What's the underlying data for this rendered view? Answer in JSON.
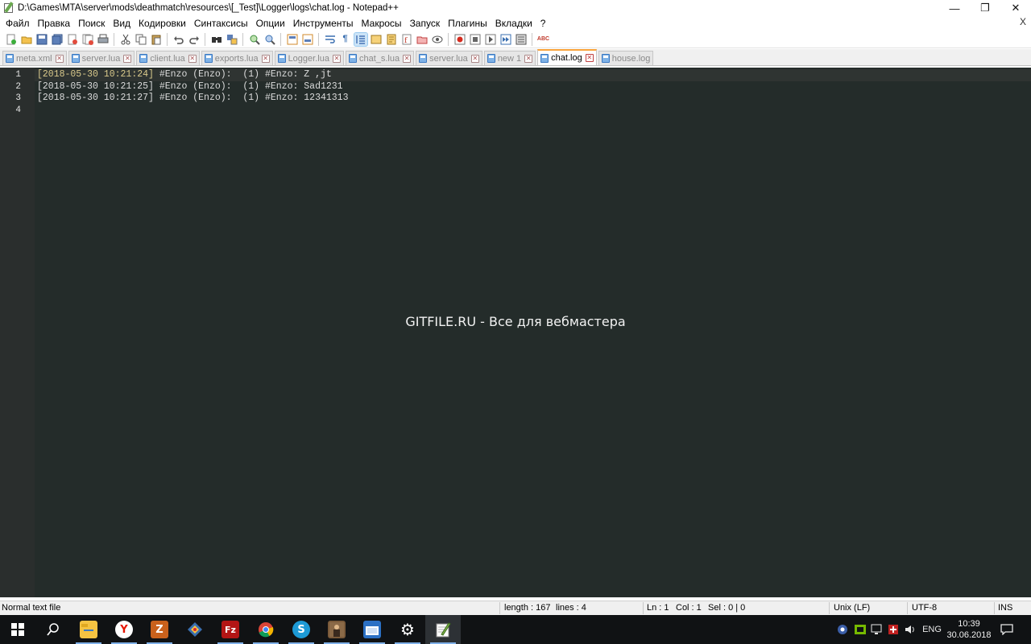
{
  "window": {
    "title": "D:\\Games\\MTA\\server\\mods\\deathmatch\\resources\\[_Test]\\Logger\\logs\\chat.log - Notepad++",
    "controls": {
      "minimize": "—",
      "restore": "❐",
      "close": "✕"
    }
  },
  "menu": {
    "items": [
      "Файл",
      "Правка",
      "Поиск",
      "Вид",
      "Кодировки",
      "Синтаксисы",
      "Опции",
      "Инструменты",
      "Макросы",
      "Запуск",
      "Плагины",
      "Вкладки",
      "?"
    ],
    "close_label": "X"
  },
  "toolbar": {
    "icons": [
      "new-icon",
      "open-icon",
      "save-icon",
      "save-all-icon",
      "close-icon",
      "close-all-icon",
      "print-icon",
      "cut-icon",
      "copy-icon",
      "paste-icon",
      "undo-icon",
      "redo-icon",
      "find-icon",
      "replace-icon",
      "zoom-in-icon",
      "zoom-out-icon",
      "sync-vertical-icon",
      "sync-horizontal-icon",
      "word-wrap-icon",
      "show-all-chars-icon",
      "indent-guide-icon",
      "user-language-icon",
      "document-map-icon",
      "function-list-icon",
      "folder-as-workspace-icon",
      "monitoring-icon",
      "record-macro-icon",
      "stop-record-icon",
      "play-macro-icon",
      "run-macro-multiple-icon",
      "save-macro-icon",
      "spell-check-icon"
    ],
    "active_icon": "indent-guide-icon"
  },
  "tabs": [
    {
      "label": "meta.xml",
      "active": false
    },
    {
      "label": "server.lua",
      "active": false
    },
    {
      "label": "client.lua",
      "active": false
    },
    {
      "label": "exports.lua",
      "active": false
    },
    {
      "label": "Logger.lua",
      "active": false
    },
    {
      "label": "chat_s.lua",
      "active": false
    },
    {
      "label": "server.lua",
      "active": false
    },
    {
      "label": "new 1",
      "active": false
    },
    {
      "label": "chat.log",
      "active": true
    },
    {
      "label": "house.log",
      "active": false
    }
  ],
  "editor": {
    "line_numbers": [
      "1",
      "2",
      "3",
      "4"
    ],
    "lines": [
      {
        "timestamp": "[2018-05-30 10:21:24]",
        "text": " #Enzo (Enzo):  (1) #Enzo: Z ,jt"
      },
      {
        "timestamp": "[2018-05-30 10:21:25]",
        "text": " #Enzo (Enzo):  (1) #Enzo: Sad1231"
      },
      {
        "timestamp": "[2018-05-30 10:21:27]",
        "text": " #Enzo (Enzo):  (1) #Enzo: 12341313"
      },
      {
        "timestamp": "",
        "text": ""
      }
    ],
    "watermark": "GITFILE.RU - Все для вебмастера",
    "colors": {
      "background": "#242c2a",
      "gutter": "#2a2e2d",
      "text": "#dcdcdc",
      "timestamp": "#d9c98b"
    }
  },
  "statusbar": {
    "file_type": "Normal text file",
    "length": "length : 167",
    "lines": "lines : 4",
    "ln": "Ln : 1",
    "col": "Col : 1",
    "sel": "Sel : 0 | 0",
    "eol": "Unix (LF)",
    "encoding": "UTF-8",
    "mode": "INS"
  },
  "taskbar": {
    "apps": [
      {
        "name": "file-explorer-icon",
        "glyph": "",
        "color": "#f5c342"
      },
      {
        "name": "yandex-browser-icon",
        "glyph": "Y",
        "color": "#e61400"
      },
      {
        "name": "filezilla-server-icon",
        "glyph": "Z",
        "color": "#c9611c"
      },
      {
        "name": "git-extensions-icon",
        "glyph": "◆",
        "color": "#3a6fb0"
      },
      {
        "name": "filezilla-icon",
        "glyph": "Fz",
        "color": "#b31515"
      },
      {
        "name": "chrome-icon",
        "glyph": "",
        "color": "#2d9a46"
      },
      {
        "name": "skype-icon",
        "glyph": "S",
        "color": "#1d9ad6"
      },
      {
        "name": "game-icon",
        "glyph": "",
        "color": "#7a5a3a"
      },
      {
        "name": "window-app-icon",
        "glyph": "▬",
        "color": "#2b70c4"
      },
      {
        "name": "settings-icon",
        "glyph": "⚙",
        "color": "#101214"
      },
      {
        "name": "notepadpp-icon",
        "glyph": "✎",
        "color": "#7bb248"
      }
    ],
    "language": "ENG",
    "time": "10:39",
    "date": "30.06.2018"
  }
}
